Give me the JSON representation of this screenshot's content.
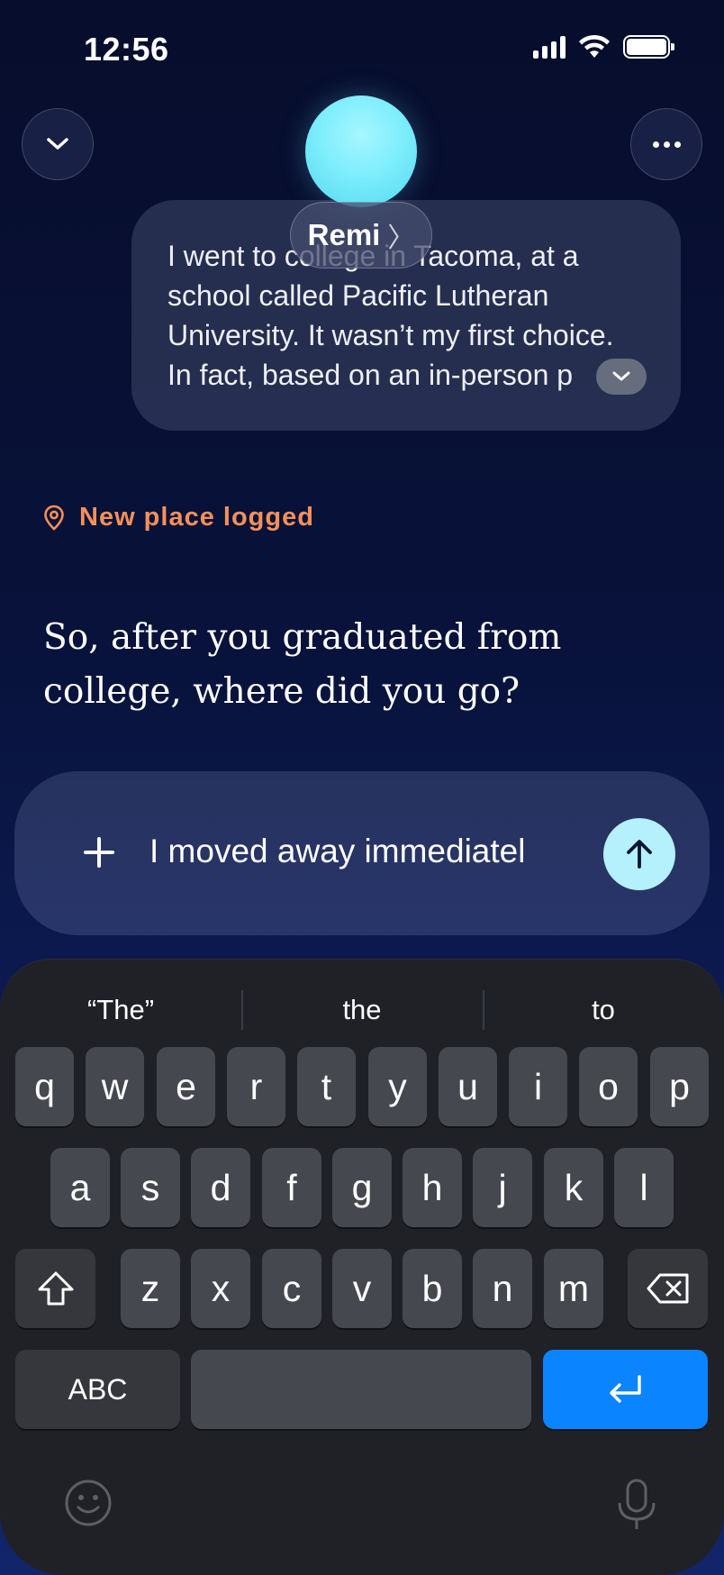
{
  "status_bar": {
    "time": "12:56"
  },
  "header": {
    "name": "Remi",
    "name_chevron": "〉",
    "collapse_icon": "chevron-down-icon",
    "more_icon": "ellipsis-icon"
  },
  "message": {
    "text": "I went to college in Tacoma, at a school called Pacific Lutheran University. It wasn’t my first choice. In fact, based on an in-person p"
  },
  "place_logged": {
    "label": "New place logged",
    "icon": "location-pin-icon",
    "color": "#f5905a"
  },
  "question": {
    "text": "So, after you graduated from college, where did you go?"
  },
  "composer": {
    "value": "I moved away immediatel",
    "plus_icon": "plus-icon",
    "send_icon": "arrow-up-icon",
    "send_color": "#b5f1fd"
  },
  "keyboard": {
    "suggestions": [
      "“The”",
      "the",
      "to"
    ],
    "row1": [
      "q",
      "w",
      "e",
      "r",
      "t",
      "y",
      "u",
      "i",
      "o",
      "p"
    ],
    "row2": [
      "a",
      "s",
      "d",
      "f",
      "g",
      "h",
      "j",
      "k",
      "l"
    ],
    "row3": [
      "z",
      "x",
      "c",
      "v",
      "b",
      "n",
      "m"
    ],
    "abc_label": "ABC",
    "return_color": "#0a84ff",
    "emoji_icon": "emoji-icon",
    "mic_icon": "microphone-icon"
  }
}
